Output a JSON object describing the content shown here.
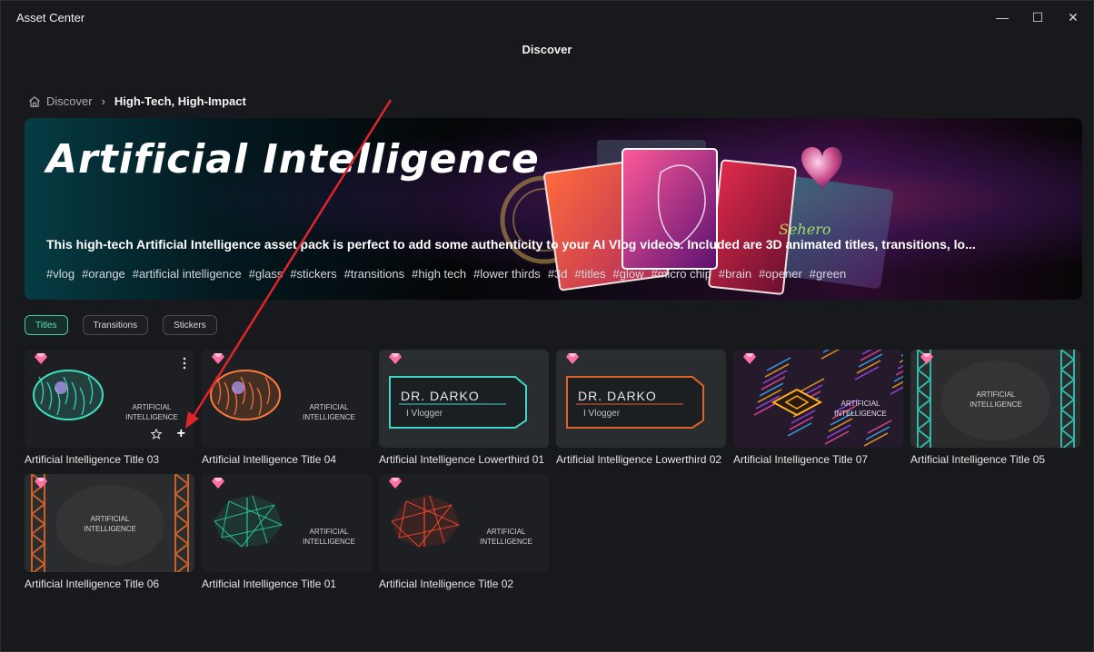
{
  "window": {
    "title": "Asset Center",
    "minimize": "—",
    "maximize": "☐",
    "close": "✕"
  },
  "header": {
    "title": "Discover"
  },
  "breadcrumb": {
    "home": "Discover",
    "separator": "›",
    "current": "High-Tech, High-Impact"
  },
  "banner": {
    "title": "Artificial Intelligence",
    "description": "This high-tech Artificial Intelligence asset pack is perfect to add some authenticity to your AI Vlog videos. Included are 3D animated titles, transitions, lo...",
    "tags": [
      "#vlog",
      "#orange",
      "#artificial intelligence",
      "#glass",
      "#stickers",
      "#transitions",
      "#high tech",
      "#lower thirds",
      "#3d",
      "#titles",
      "#glow",
      "#micro chip",
      "#brain",
      "#opener",
      "#green"
    ]
  },
  "filters": [
    {
      "label": "Titles",
      "active": true
    },
    {
      "label": "Transitions",
      "active": false
    },
    {
      "label": "Stickers",
      "active": false
    }
  ],
  "assets": [
    {
      "name": "Artificial Intelligence Title 03",
      "style": "brain",
      "color": "#3fe0c0",
      "text": "ARTIFICIAL\nINTELLIGENCE"
    },
    {
      "name": "Artificial Intelligence Title 04",
      "style": "brain",
      "color": "#ff7a3a",
      "text": "ARTIFICIAL\nINTELLIGENCE"
    },
    {
      "name": "Artificial Intelligence Lowerthird 01",
      "style": "lowerthird",
      "color": "#3fd6c8",
      "text": "DR. DARKO\nI Vlogger"
    },
    {
      "name": "Artificial Intelligence Lowerthird 02",
      "style": "lowerthird",
      "color": "#e0622a",
      "text": "DR. DARKO\nI Vlogger"
    },
    {
      "name": "Artificial Intelligence Title 07",
      "style": "chip",
      "color": "#ffb020",
      "text": "ARTIFICIAL\nINTELLIGENCE"
    },
    {
      "name": "Artificial Intelligence Title 05",
      "style": "frame",
      "color": "#2fb8a8",
      "text": "ARTIFICIAL\nINTELLIGENCE"
    },
    {
      "name": "Artificial Intelligence Title 06",
      "style": "frame",
      "color": "#c8622a",
      "text": "ARTIFICIAL\nINTELLIGENCE"
    },
    {
      "name": "Artificial Intelligence Title 01",
      "style": "wire",
      "color": "#28d0a0",
      "text": "ARTIFICIAL\nINTELLIGENCE"
    },
    {
      "name": "Artificial Intelligence Title 02",
      "style": "wire",
      "color": "#ff4a2a",
      "text": "ARTIFICIAL\nINTELLIGENCE"
    }
  ],
  "hover_actions": {
    "star": "favorite",
    "add": "+"
  },
  "icons": {
    "home": "home-icon",
    "gem": "premium-gem-icon",
    "more": "more-vertical-icon",
    "star": "star-icon",
    "add": "plus-icon"
  },
  "colors": {
    "accent": "#46c8a6",
    "annotation_arrow": "#e0242c",
    "gem": "#ff6fa3"
  }
}
